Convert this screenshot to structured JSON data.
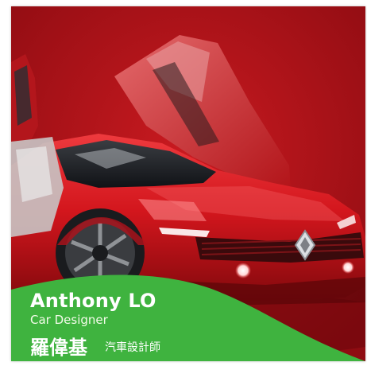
{
  "profile": {
    "name_en": "Anthony LO",
    "title_en": "Car Designer",
    "name_zh": "羅偉基",
    "title_zh": "汽車設計師"
  },
  "icons": {
    "car": "car-photo",
    "brand": "renault-logo-icon"
  },
  "colors": {
    "background": "#b4121a",
    "car_body": "#d0141c",
    "caption_green": "#3fb33f",
    "text": "#ffffff"
  }
}
